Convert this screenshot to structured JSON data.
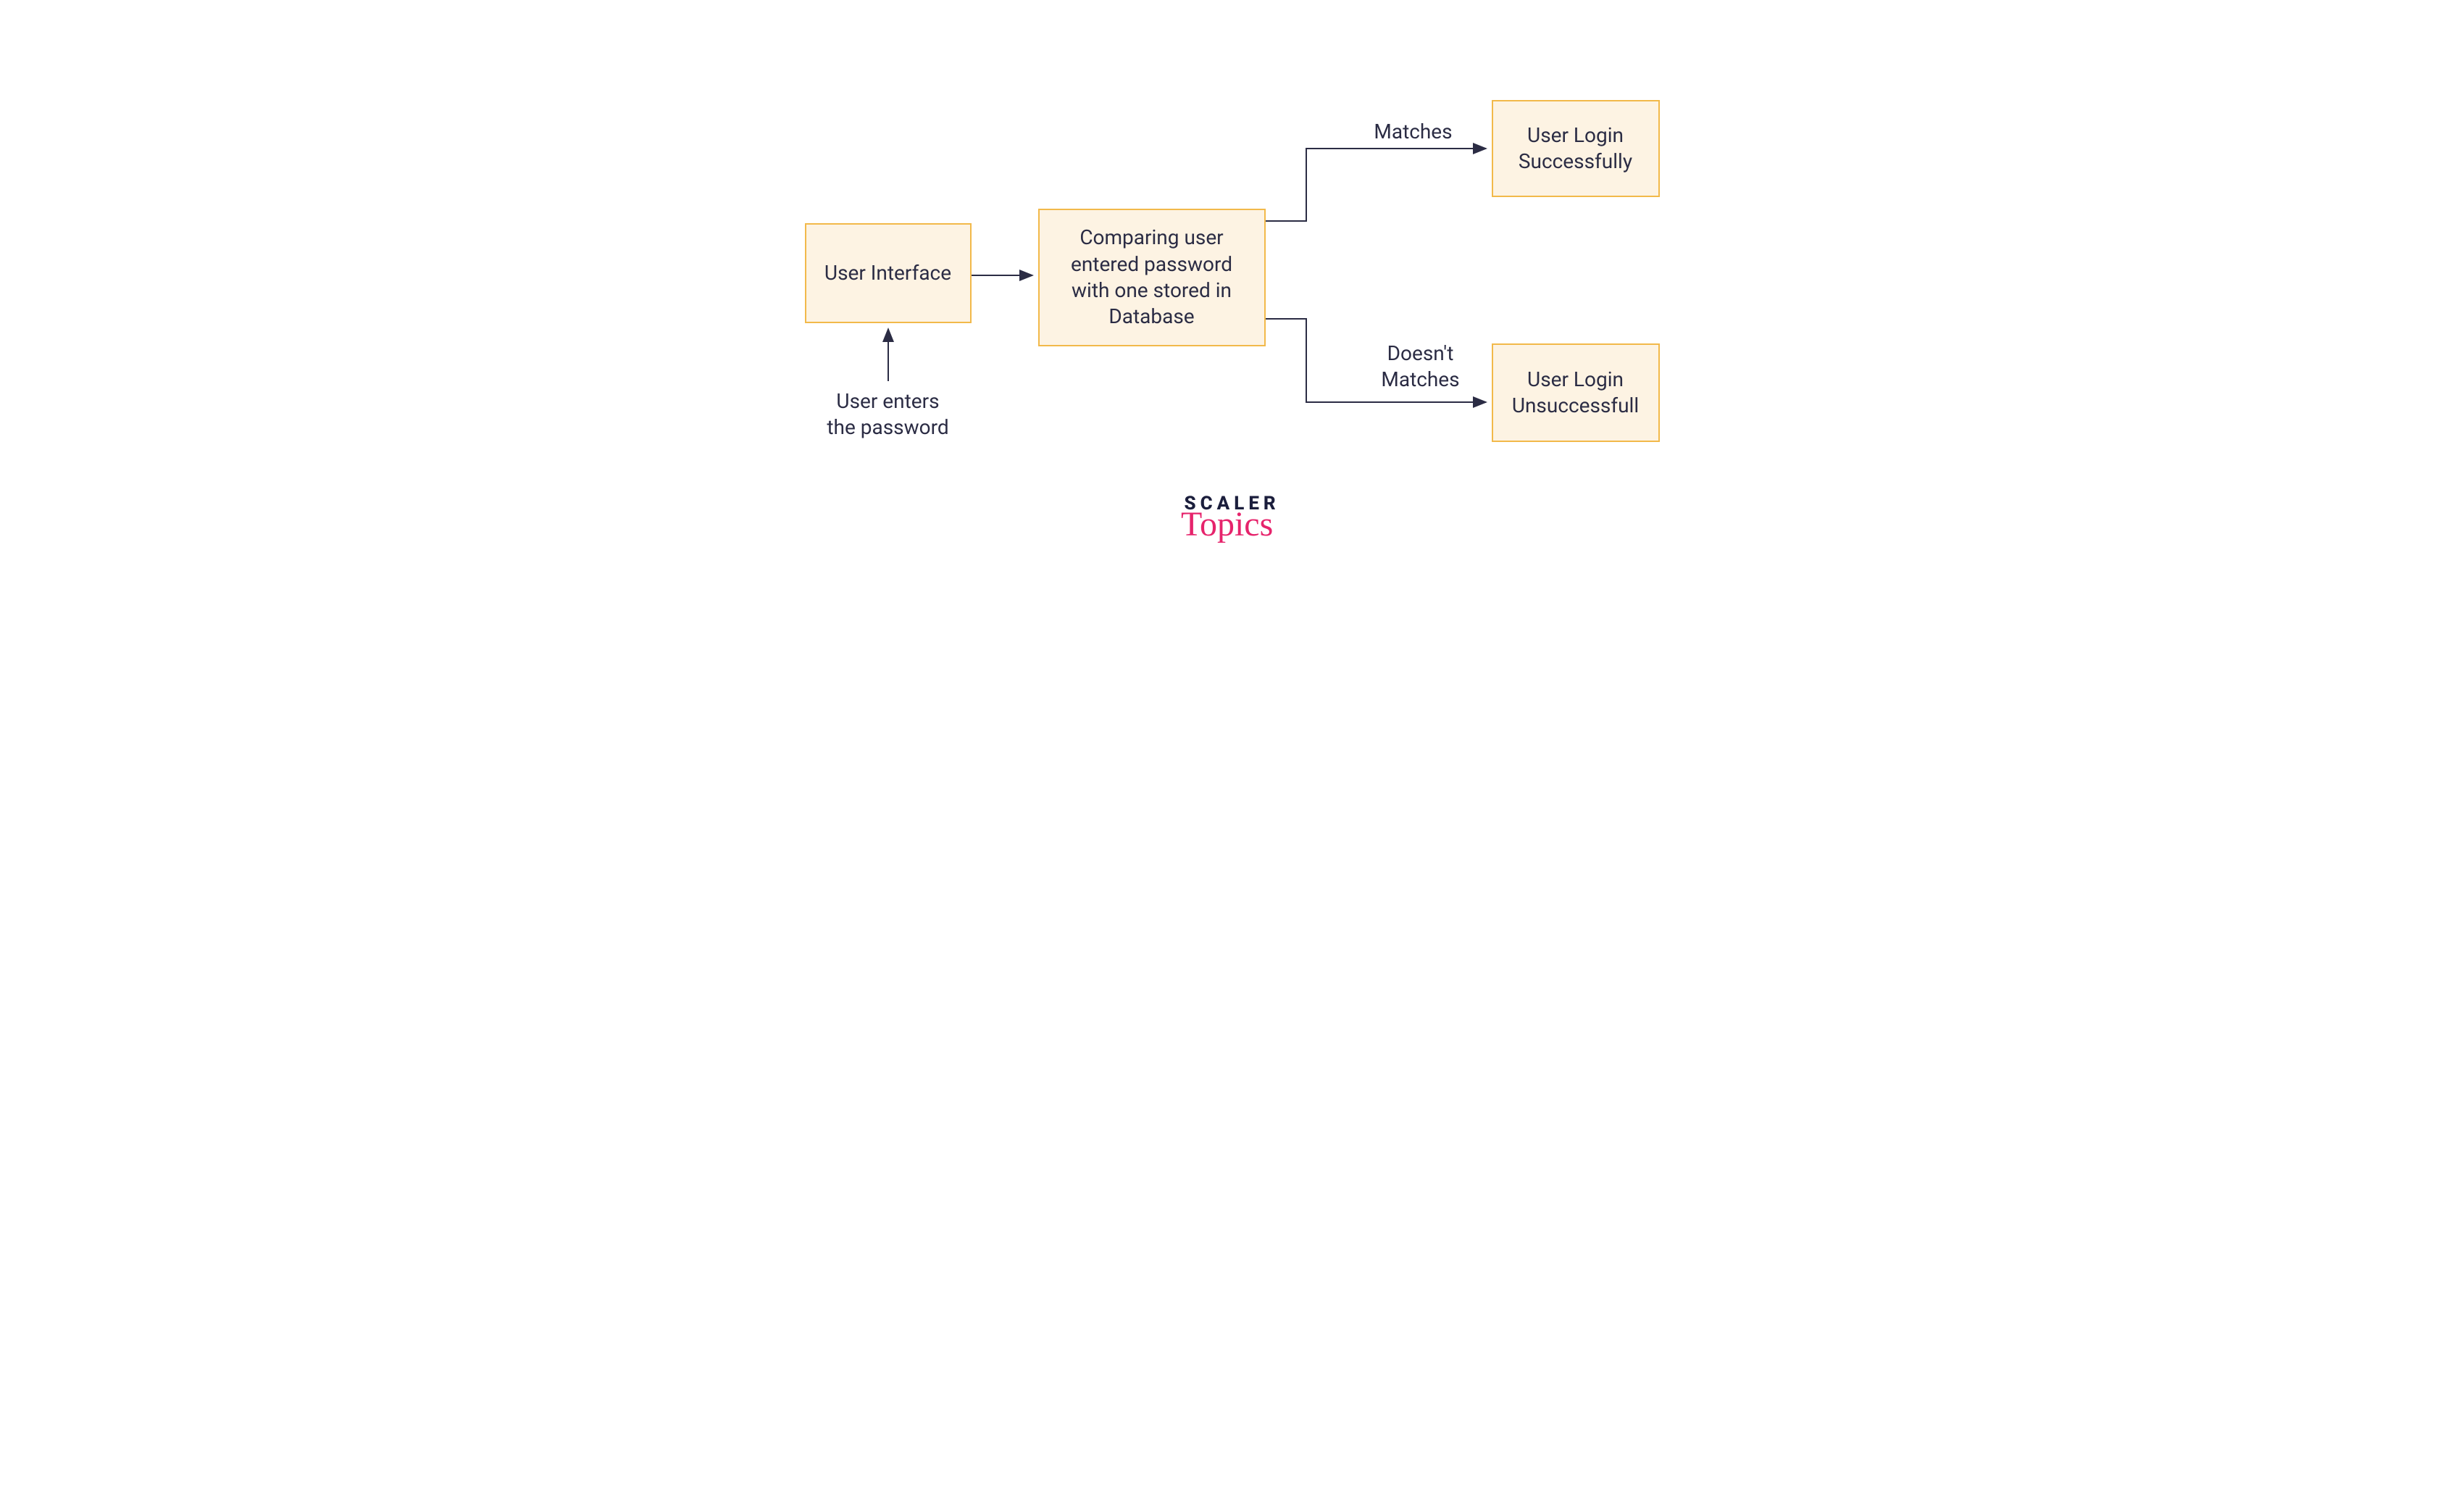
{
  "nodes": {
    "ui": {
      "text": "User\nInterface"
    },
    "compare": {
      "text": "Comparing user\nentered password\nwith one stored in\nDatabase"
    },
    "success": {
      "text": "User Login\nSuccessfully"
    },
    "fail": {
      "text": "User Login\nUnsuccessfull"
    }
  },
  "labels": {
    "enter": "User enters\nthe password",
    "matches": "Matches",
    "doesnt": "Doesn't\nMatches"
  },
  "logo": {
    "line1": "SCALER",
    "line2": "Topics"
  },
  "colors": {
    "node_fill": "#fdf3e3",
    "node_border": "#f2b94a",
    "arrow_stroke": "#2b2c44",
    "logo_dark": "#1b1e3c",
    "logo_pink": "#e6246c"
  }
}
